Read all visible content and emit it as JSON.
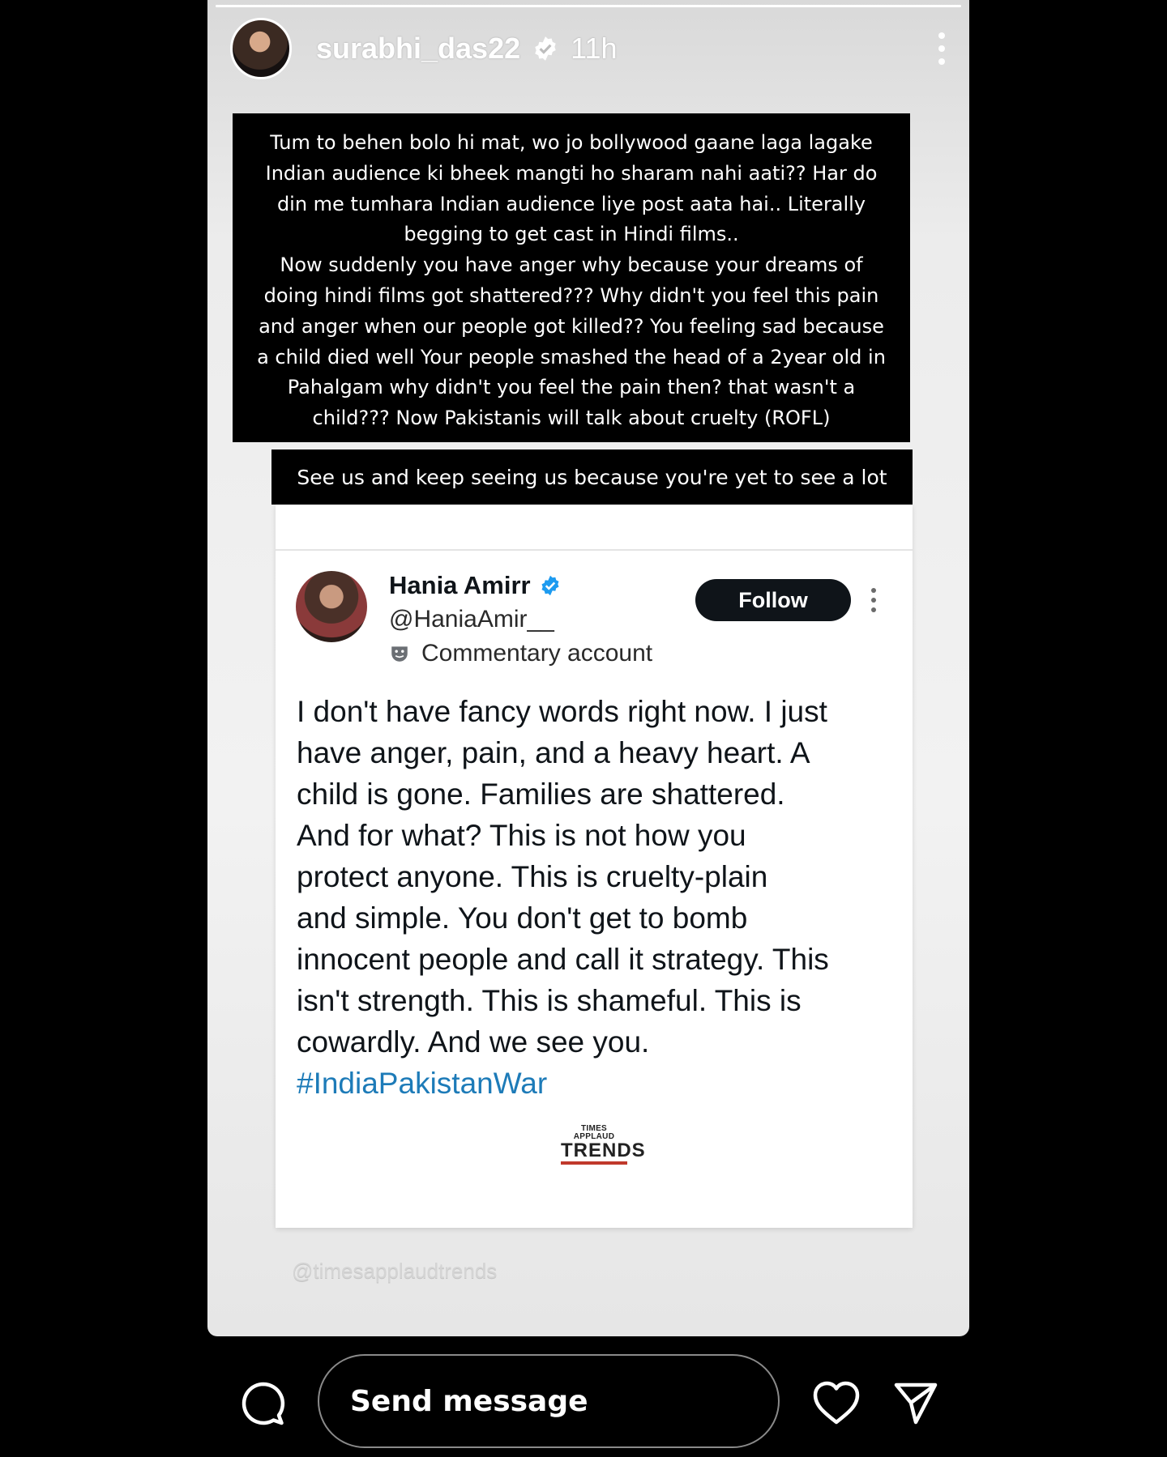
{
  "story": {
    "progress": 1.0,
    "username": "surabhi_das22",
    "time": "11h",
    "icons": {
      "avatar": "profile-photo",
      "verified": "verified-badge-icon",
      "more": "more-vertical-icon"
    }
  },
  "caption": {
    "lines": [
      "Tum to behen bolo hi mat, wo jo bollywood gaane laga lagake",
      "Indian audience ki bheek mangti ho sharam nahi aati?? Har do",
      "din me tumhara Indian audience liye post aata hai.. Literally",
      "begging to get cast in Hindi films..",
      "Now suddenly you have anger why because your dreams of",
      "doing hindi films got shattered???  Why didn't you feel this pain",
      "and anger when our people got killed?? You feeling sad because",
      "a child died  well Your people smashed the head of a 2year old in",
      "Pahalgam why didn't you feel the pain then? that wasn't a",
      "child??? Now Pakistanis will talk about cruelty (ROFL)"
    ],
    "secondary": "See us and keep seeing us because you're yet to see a lot"
  },
  "tweet": {
    "name": "Hania Amirr",
    "handle": "@HaniaAmir__",
    "label": "Commentary account",
    "follow_label": "Follow",
    "body_lines": [
      "I don't have fancy words right now. I just",
      "have anger, pain, and a heavy heart. A",
      "child is gone. Families are shattered.",
      "And for what? This is not how you",
      "protect anyone. This is cruelty-plain",
      "and simple. You don't get to bomb",
      "innocent people and call it strategy. This",
      "isn't strength. This is shameful. This is",
      "cowardly. And we see you."
    ],
    "hashtag": "#IndiaPakistanWar",
    "logo_top": "TIMES APPLAUD",
    "logo_main": "TRENDS"
  },
  "watermark": "@timesapplaudtrends",
  "reply_bar": {
    "placeholder": "Send message",
    "icons": {
      "reply": "speech-bubble-icon",
      "like": "heart-icon",
      "share": "send-icon"
    }
  },
  "colors": {
    "background": "#000000",
    "hashtag": "#1d7bb8",
    "verified": "#1d9bf0"
  }
}
